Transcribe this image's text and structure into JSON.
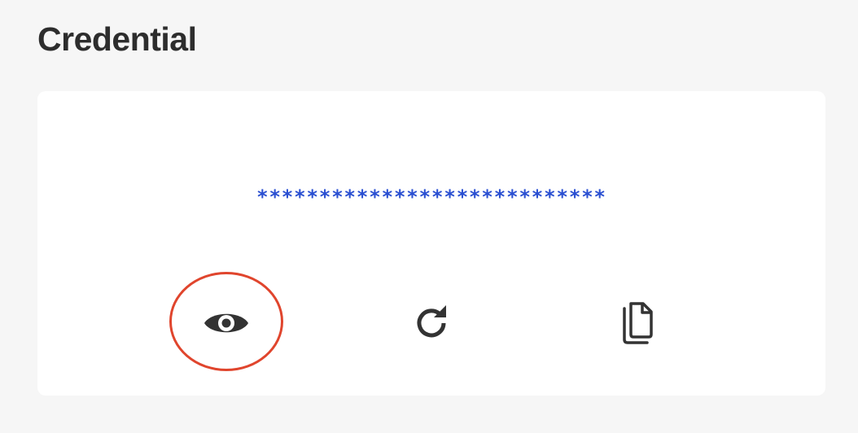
{
  "page": {
    "title": "Credential"
  },
  "credential": {
    "masked_value": "****************************"
  },
  "actions": {
    "reveal": {
      "icon": "eye-icon"
    },
    "regenerate": {
      "icon": "refresh-icon"
    },
    "copy": {
      "icon": "copy-icon"
    }
  },
  "colors": {
    "background": "#f6f6f6",
    "card": "#ffffff",
    "masked_text": "#2a4fd1",
    "icon": "#333333",
    "highlight": "#e0452d"
  }
}
